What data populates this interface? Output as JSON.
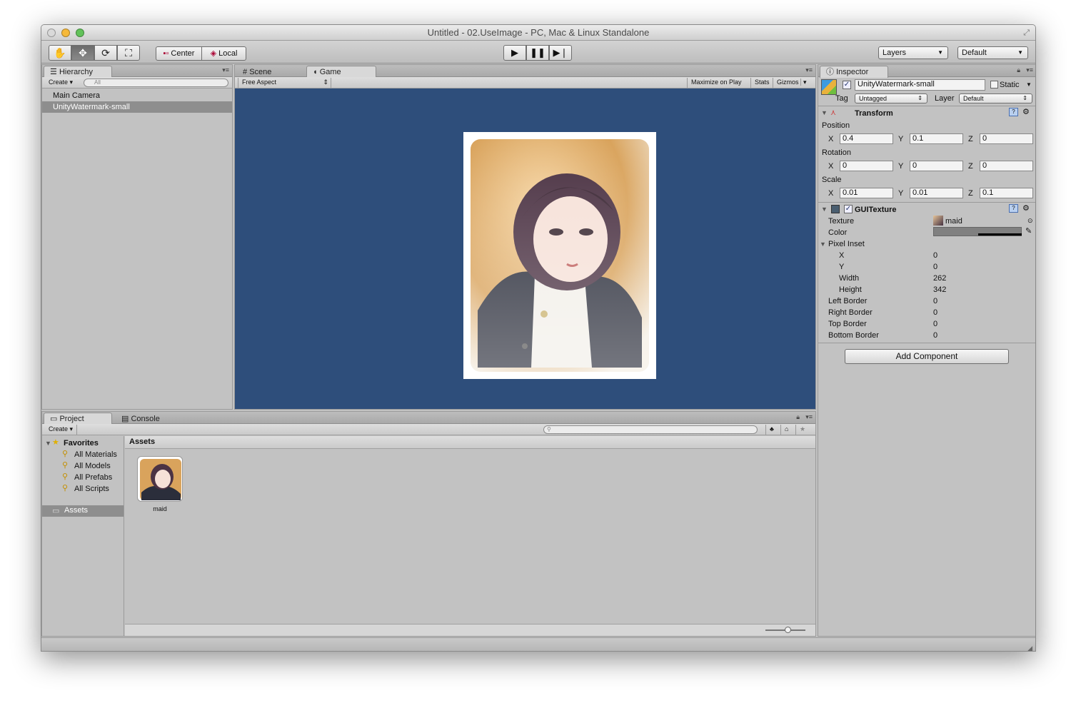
{
  "window": {
    "title": "Untitled - 02.UseImage - PC, Mac & Linux Standalone"
  },
  "toolbar": {
    "center_label": "Center",
    "local_label": "Local",
    "layers_label": "Layers",
    "layout_label": "Default"
  },
  "hierarchy": {
    "tab_label": "Hierarchy",
    "create_label": "Create",
    "search_placeholder": "All",
    "items": [
      "Main Camera",
      "UnityWatermark-small"
    ]
  },
  "scene": {
    "tab_label": "Scene"
  },
  "game": {
    "tab_label": "Game",
    "aspect_label": "Free Aspect",
    "maximize_label": "Maximize on Play",
    "stats_label": "Stats",
    "gizmos_label": "Gizmos"
  },
  "inspector": {
    "tab_label": "Inspector",
    "object_name": "UnityWatermark-small",
    "static_label": "Static",
    "tag_label": "Tag",
    "tag_value": "Untagged",
    "layer_label": "Layer",
    "layer_value": "Default",
    "transform": {
      "title": "Transform",
      "position_label": "Position",
      "rotation_label": "Rotation",
      "scale_label": "Scale",
      "axis_x": "X",
      "axis_y": "Y",
      "axis_z": "Z",
      "position": [
        "0.4",
        "0.1",
        "0"
      ],
      "rotation": [
        "0",
        "0",
        "0"
      ],
      "scale": [
        "0.01",
        "0.01",
        "0.1"
      ]
    },
    "guitexture": {
      "title": "GUITexture",
      "texture_label": "Texture",
      "texture_value": "maid",
      "color_label": "Color",
      "pixel_inset_label": "Pixel Inset",
      "x_label": "X",
      "x_value": "0",
      "y_label": "Y",
      "y_value": "0",
      "width_label": "Width",
      "width_value": "262",
      "height_label": "Height",
      "height_value": "342",
      "left_border_label": "Left Border",
      "left_border_value": "0",
      "right_border_label": "Right Border",
      "right_border_value": "0",
      "top_border_label": "Top Border",
      "top_border_value": "0",
      "bottom_border_label": "Bottom Border",
      "bottom_border_value": "0"
    },
    "add_component_label": "Add Component"
  },
  "project": {
    "tab_label": "Project",
    "console_tab_label": "Console",
    "create_label": "Create",
    "favorites_label": "Favorites",
    "favorites": [
      "All Materials",
      "All Models",
      "All Prefabs",
      "All Scripts"
    ],
    "assets_folder_label": "Assets",
    "breadcrumb": "Assets",
    "asset_items": [
      {
        "name": "maid"
      }
    ]
  },
  "colors": {
    "game_background": "#2e4e7b",
    "selection": "#8e8e8e"
  }
}
